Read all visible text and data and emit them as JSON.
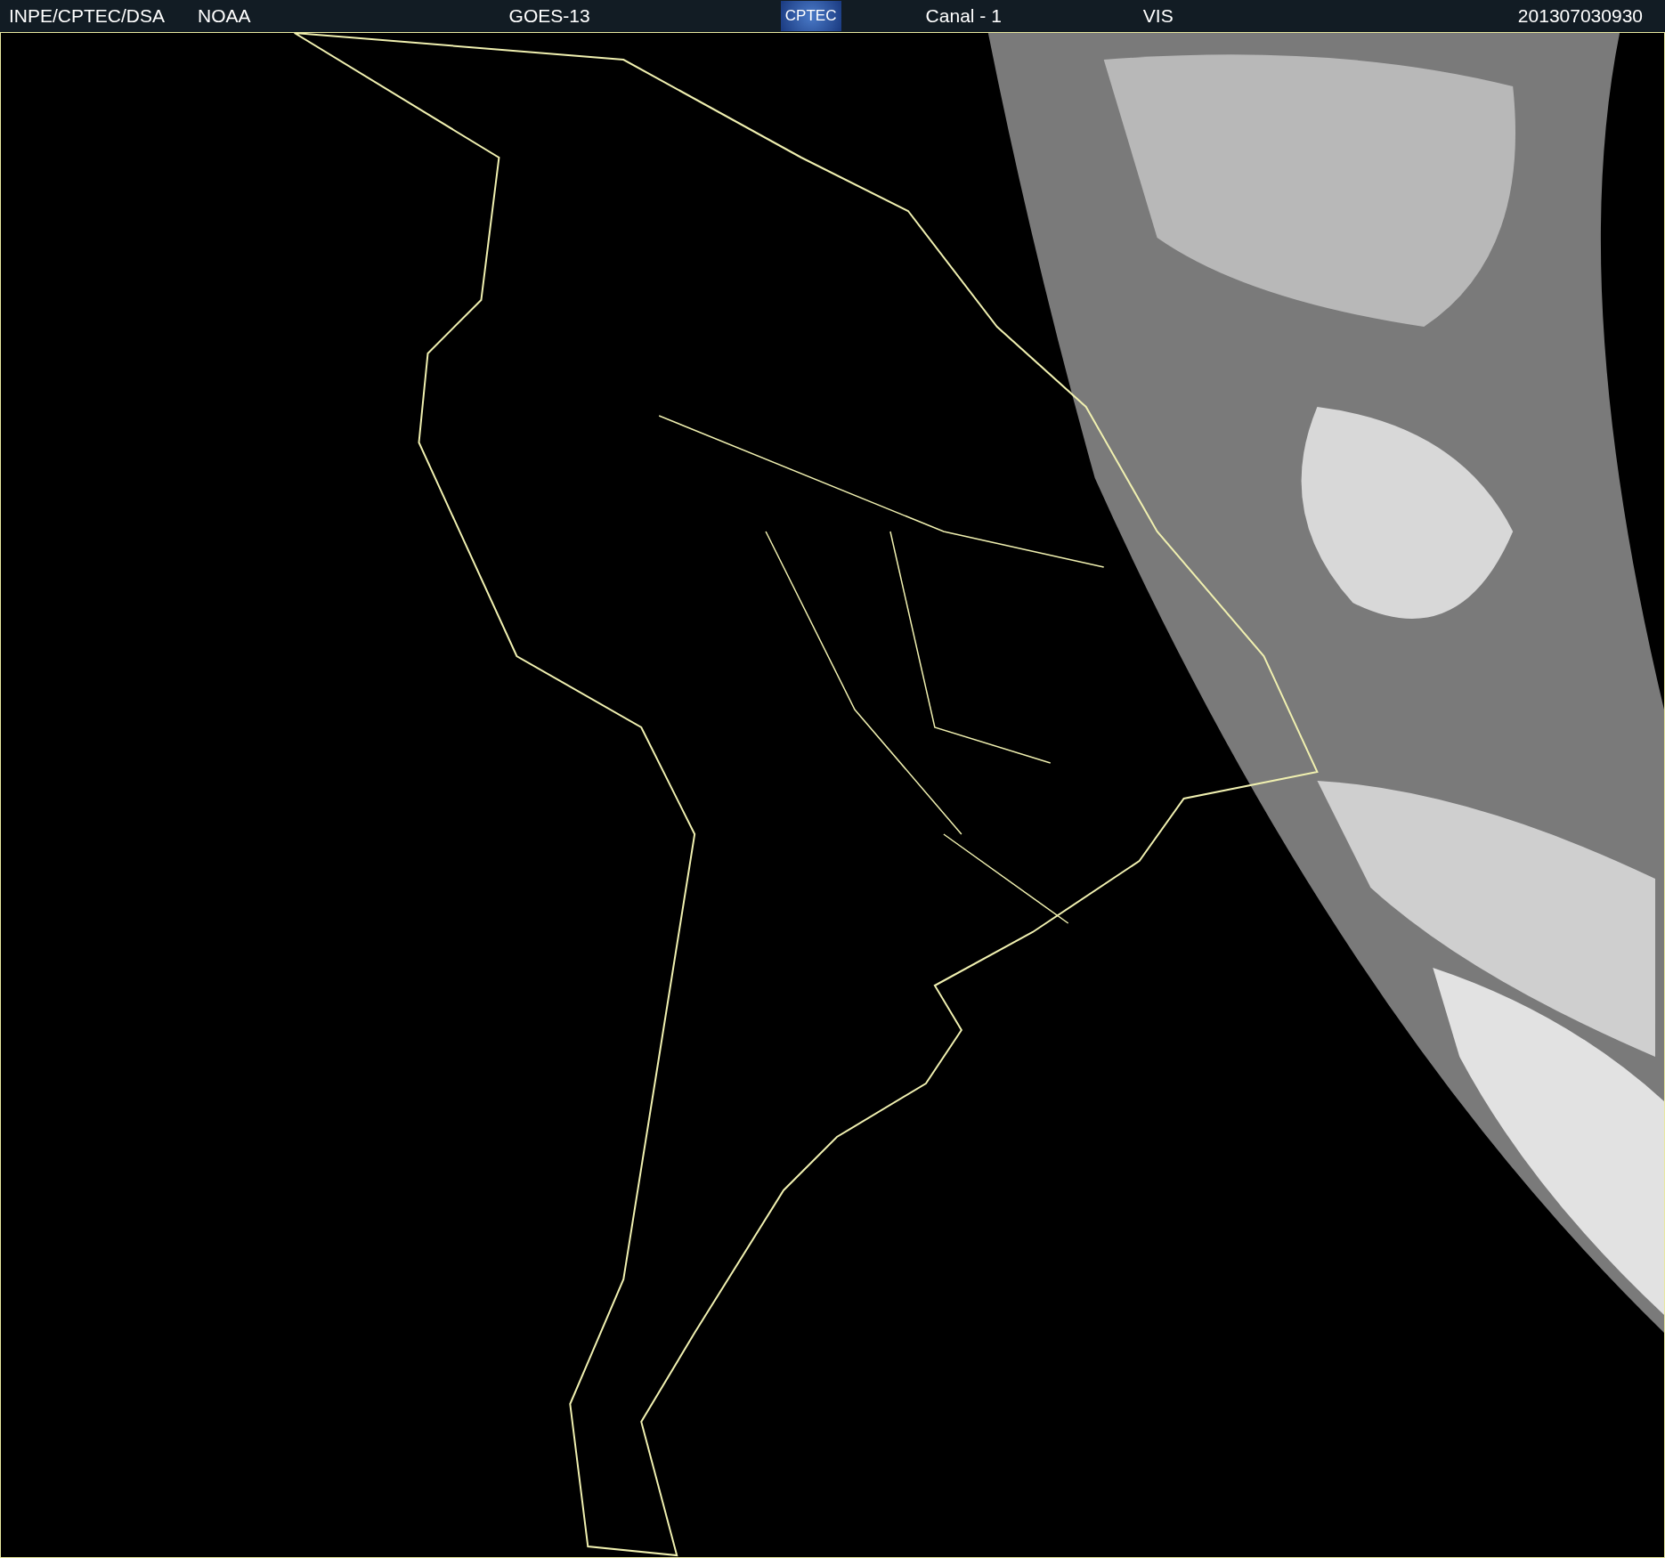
{
  "header": {
    "source": "INPE/CPTEC/DSA",
    "agency": "NOAA",
    "satellite": "GOES-13",
    "logo": "CPTEC",
    "channel": "Canal - 1",
    "band": "VIS",
    "timestamp": "201307030930"
  }
}
